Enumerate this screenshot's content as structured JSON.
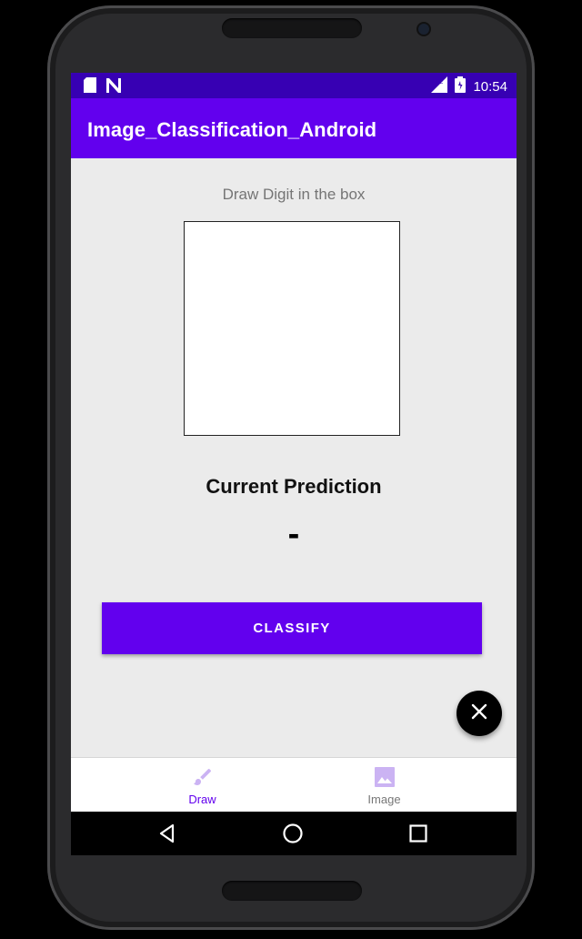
{
  "status_bar": {
    "time": "10:54",
    "left_icons": [
      "sd-card-icon",
      "n-notification-icon"
    ],
    "right_icons": [
      "signal-icon",
      "battery-icon"
    ]
  },
  "app_bar": {
    "title": "Image_Classification_Android"
  },
  "main": {
    "instruction": "Draw Digit in the box",
    "prediction_title": "Current Prediction",
    "prediction_value": "-",
    "classify_label": "CLASSIFY"
  },
  "fab": {
    "icon": "close-icon"
  },
  "bottom_nav": {
    "items": [
      {
        "label": "Draw",
        "icon": "brush-icon",
        "active": true
      },
      {
        "label": "Image",
        "icon": "image-icon",
        "active": false
      }
    ]
  },
  "system_nav": {
    "buttons": [
      "back-icon",
      "home-icon",
      "recents-icon"
    ]
  },
  "colors": {
    "primary": "#6200ee",
    "primary_dark": "#3700b3",
    "background": "#ebebeb",
    "inactive": "#cbb3f3"
  }
}
